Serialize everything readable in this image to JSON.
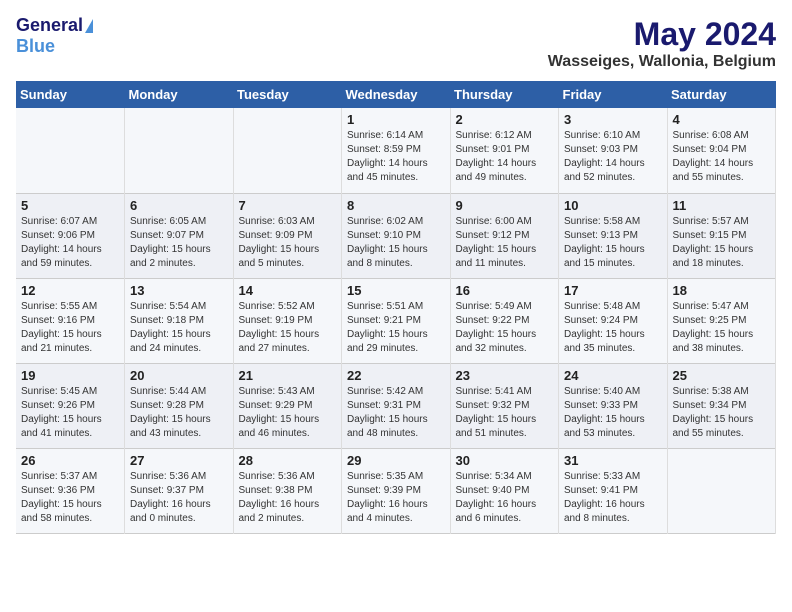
{
  "header": {
    "logo_general": "General",
    "logo_blue": "Blue",
    "month": "May 2024",
    "location": "Wasseiges, Wallonia, Belgium"
  },
  "days_of_week": [
    "Sunday",
    "Monday",
    "Tuesday",
    "Wednesday",
    "Thursday",
    "Friday",
    "Saturday"
  ],
  "weeks": [
    [
      {
        "day": "",
        "info": ""
      },
      {
        "day": "",
        "info": ""
      },
      {
        "day": "",
        "info": ""
      },
      {
        "day": "1",
        "info": "Sunrise: 6:14 AM\nSunset: 8:59 PM\nDaylight: 14 hours\nand 45 minutes."
      },
      {
        "day": "2",
        "info": "Sunrise: 6:12 AM\nSunset: 9:01 PM\nDaylight: 14 hours\nand 49 minutes."
      },
      {
        "day": "3",
        "info": "Sunrise: 6:10 AM\nSunset: 9:03 PM\nDaylight: 14 hours\nand 52 minutes."
      },
      {
        "day": "4",
        "info": "Sunrise: 6:08 AM\nSunset: 9:04 PM\nDaylight: 14 hours\nand 55 minutes."
      }
    ],
    [
      {
        "day": "5",
        "info": "Sunrise: 6:07 AM\nSunset: 9:06 PM\nDaylight: 14 hours\nand 59 minutes."
      },
      {
        "day": "6",
        "info": "Sunrise: 6:05 AM\nSunset: 9:07 PM\nDaylight: 15 hours\nand 2 minutes."
      },
      {
        "day": "7",
        "info": "Sunrise: 6:03 AM\nSunset: 9:09 PM\nDaylight: 15 hours\nand 5 minutes."
      },
      {
        "day": "8",
        "info": "Sunrise: 6:02 AM\nSunset: 9:10 PM\nDaylight: 15 hours\nand 8 minutes."
      },
      {
        "day": "9",
        "info": "Sunrise: 6:00 AM\nSunset: 9:12 PM\nDaylight: 15 hours\nand 11 minutes."
      },
      {
        "day": "10",
        "info": "Sunrise: 5:58 AM\nSunset: 9:13 PM\nDaylight: 15 hours\nand 15 minutes."
      },
      {
        "day": "11",
        "info": "Sunrise: 5:57 AM\nSunset: 9:15 PM\nDaylight: 15 hours\nand 18 minutes."
      }
    ],
    [
      {
        "day": "12",
        "info": "Sunrise: 5:55 AM\nSunset: 9:16 PM\nDaylight: 15 hours\nand 21 minutes."
      },
      {
        "day": "13",
        "info": "Sunrise: 5:54 AM\nSunset: 9:18 PM\nDaylight: 15 hours\nand 24 minutes."
      },
      {
        "day": "14",
        "info": "Sunrise: 5:52 AM\nSunset: 9:19 PM\nDaylight: 15 hours\nand 27 minutes."
      },
      {
        "day": "15",
        "info": "Sunrise: 5:51 AM\nSunset: 9:21 PM\nDaylight: 15 hours\nand 29 minutes."
      },
      {
        "day": "16",
        "info": "Sunrise: 5:49 AM\nSunset: 9:22 PM\nDaylight: 15 hours\nand 32 minutes."
      },
      {
        "day": "17",
        "info": "Sunrise: 5:48 AM\nSunset: 9:24 PM\nDaylight: 15 hours\nand 35 minutes."
      },
      {
        "day": "18",
        "info": "Sunrise: 5:47 AM\nSunset: 9:25 PM\nDaylight: 15 hours\nand 38 minutes."
      }
    ],
    [
      {
        "day": "19",
        "info": "Sunrise: 5:45 AM\nSunset: 9:26 PM\nDaylight: 15 hours\nand 41 minutes."
      },
      {
        "day": "20",
        "info": "Sunrise: 5:44 AM\nSunset: 9:28 PM\nDaylight: 15 hours\nand 43 minutes."
      },
      {
        "day": "21",
        "info": "Sunrise: 5:43 AM\nSunset: 9:29 PM\nDaylight: 15 hours\nand 46 minutes."
      },
      {
        "day": "22",
        "info": "Sunrise: 5:42 AM\nSunset: 9:31 PM\nDaylight: 15 hours\nand 48 minutes."
      },
      {
        "day": "23",
        "info": "Sunrise: 5:41 AM\nSunset: 9:32 PM\nDaylight: 15 hours\nand 51 minutes."
      },
      {
        "day": "24",
        "info": "Sunrise: 5:40 AM\nSunset: 9:33 PM\nDaylight: 15 hours\nand 53 minutes."
      },
      {
        "day": "25",
        "info": "Sunrise: 5:38 AM\nSunset: 9:34 PM\nDaylight: 15 hours\nand 55 minutes."
      }
    ],
    [
      {
        "day": "26",
        "info": "Sunrise: 5:37 AM\nSunset: 9:36 PM\nDaylight: 15 hours\nand 58 minutes."
      },
      {
        "day": "27",
        "info": "Sunrise: 5:36 AM\nSunset: 9:37 PM\nDaylight: 16 hours\nand 0 minutes."
      },
      {
        "day": "28",
        "info": "Sunrise: 5:36 AM\nSunset: 9:38 PM\nDaylight: 16 hours\nand 2 minutes."
      },
      {
        "day": "29",
        "info": "Sunrise: 5:35 AM\nSunset: 9:39 PM\nDaylight: 16 hours\nand 4 minutes."
      },
      {
        "day": "30",
        "info": "Sunrise: 5:34 AM\nSunset: 9:40 PM\nDaylight: 16 hours\nand 6 minutes."
      },
      {
        "day": "31",
        "info": "Sunrise: 5:33 AM\nSunset: 9:41 PM\nDaylight: 16 hours\nand 8 minutes."
      },
      {
        "day": "",
        "info": ""
      }
    ]
  ]
}
